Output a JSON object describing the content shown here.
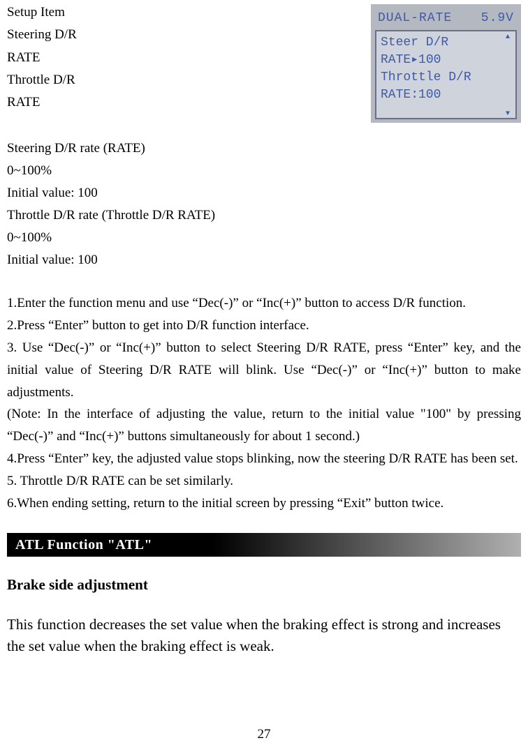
{
  "setup": {
    "title": "Setup Item",
    "items": [
      "Steering D/R",
      "RATE",
      "Throttle D/R",
      "RATE"
    ]
  },
  "lcd": {
    "header_left": "DUAL-RATE",
    "header_right": "5.9V",
    "line1": "Steer D/R",
    "line2": "RATE▸100",
    "line3": "",
    "line4": "Throttle D/R",
    "line5": "RATE:100"
  },
  "spec": {
    "l1": "Steering D/R rate (RATE)",
    "l2": "0~100%",
    "l3": "Initial value: 100",
    "l4": "Throttle D/R rate (Throttle D/R RATE)",
    "l5": "0~100%",
    "l6": "Initial value: 100"
  },
  "instructions": {
    "p1": "1.Enter  the  function  menu  and  use    “Dec(-)”  or  “Inc(+)”  button  to  access  D/R function.",
    "p2": "2.Press “Enter” button to get into D/R function interface.",
    "p3": "3. Use    “Dec(-)” or “Inc(+)” button to select Steering D/R RATE, press “Enter” key, and  the  initial  value  of  Steering  D/R  RATE  will  blink.  Use  “Dec(-)”  or  “Inc(+)” button to make adjustments.",
    "p4": "(Note:  In  the  interface  of  adjusting  the  value,  return  to  the  initial  value  \"100\"  by pressing “Dec(-)” and “Inc(+)” buttons simultaneously for about 1 second.)",
    "p5": "4.Press    “Enter” key, the adjusted value stops blinking, now the steering D/R RATE has been set.",
    "p6": "5. Throttle D/R RATE can be set similarly.",
    "p7": "6.When ending setting, return to the initial screen by pressing “Exit” button twice."
  },
  "section": {
    "bar": "ATL Function    \"ATL\"",
    "subtitle": "Brake side adjustment",
    "description": "This function decreases the set value when the braking effect is strong and increases the set value when the braking effect is weak."
  },
  "page_number": "27"
}
